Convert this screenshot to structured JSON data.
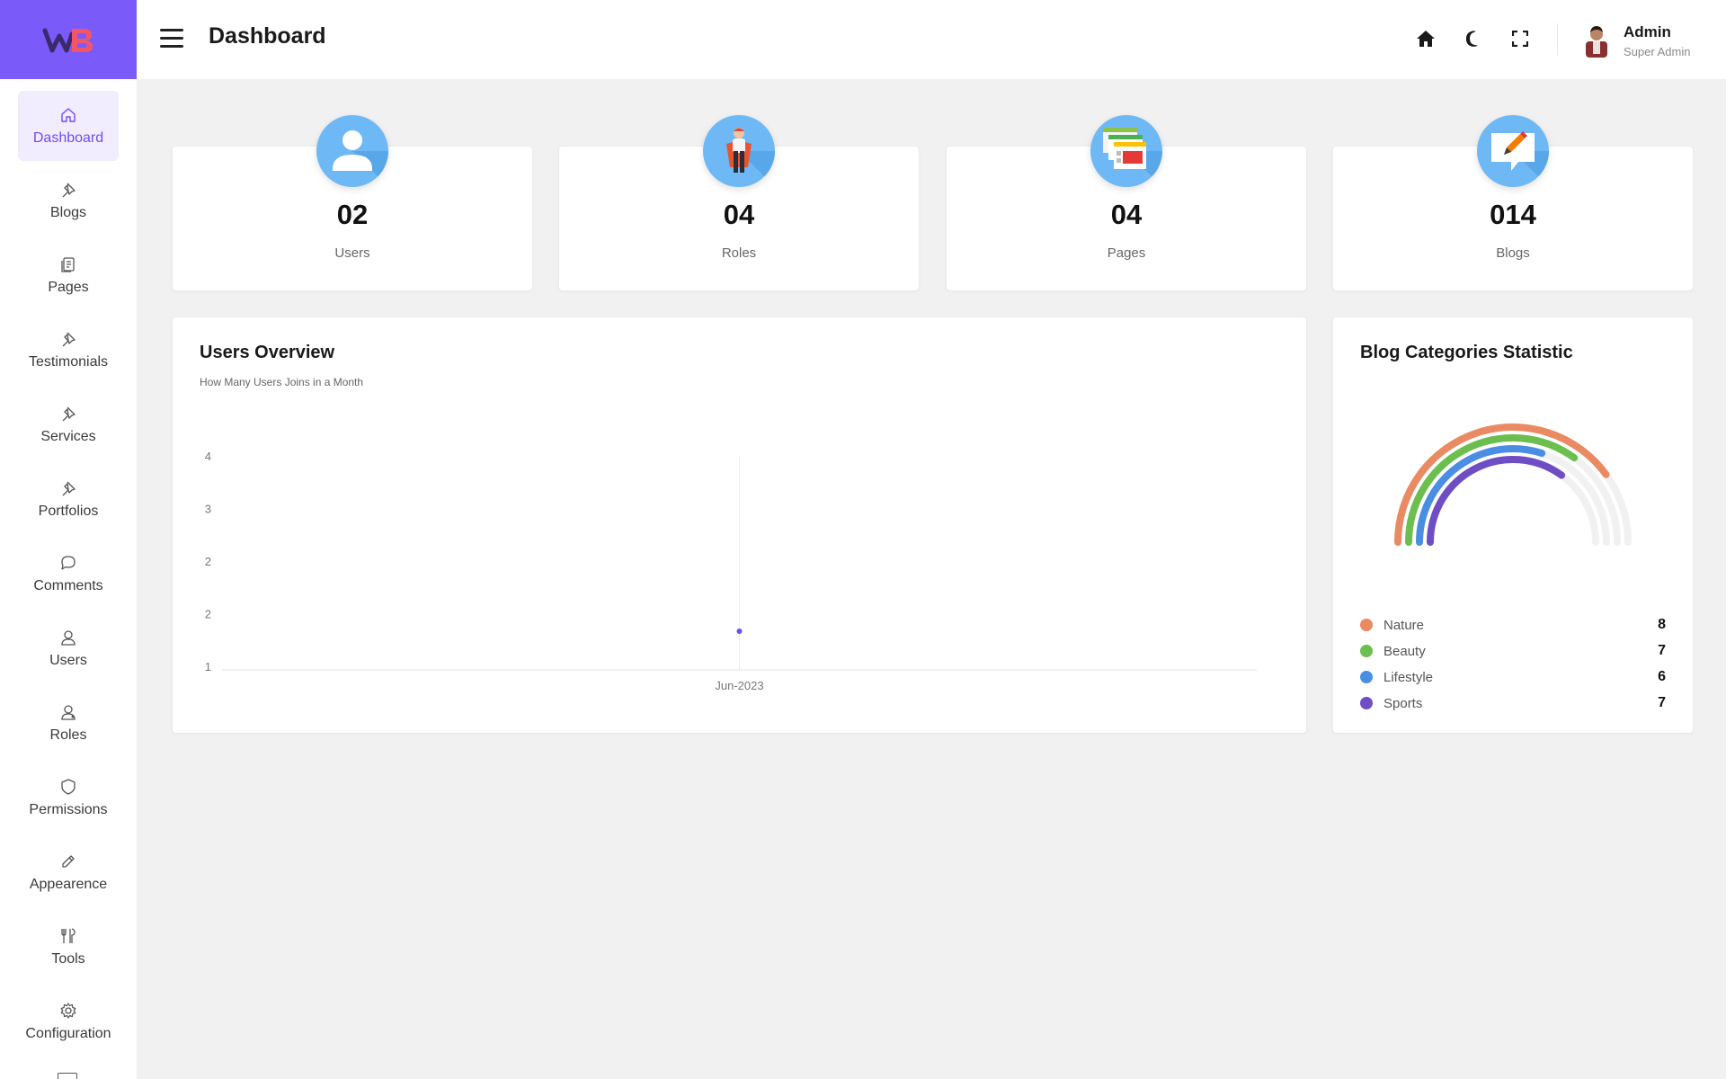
{
  "brand": {
    "accent": "#7a5af8"
  },
  "header": {
    "title": "Dashboard"
  },
  "user": {
    "name": "Admin",
    "role": "Super Admin"
  },
  "sidebar": {
    "items": [
      {
        "label": "Dashboard",
        "icon": "home-icon"
      },
      {
        "label": "Blogs",
        "icon": "pin-icon"
      },
      {
        "label": "Pages",
        "icon": "pages-icon"
      },
      {
        "label": "Testimonials",
        "icon": "pin-icon"
      },
      {
        "label": "Services",
        "icon": "pin-icon"
      },
      {
        "label": "Portfolios",
        "icon": "pin-icon"
      },
      {
        "label": "Comments",
        "icon": "comment-icon"
      },
      {
        "label": "Users",
        "icon": "user-icon"
      },
      {
        "label": "Roles",
        "icon": "roles-icon"
      },
      {
        "label": "Permissions",
        "icon": "shield-icon"
      },
      {
        "label": "Appearence",
        "icon": "pencil-icon"
      },
      {
        "label": "Tools",
        "icon": "tools-icon"
      },
      {
        "label": "Configuration",
        "icon": "gear-icon"
      }
    ]
  },
  "stats": [
    {
      "value": "02",
      "label": "Users"
    },
    {
      "value": "04",
      "label": "Roles"
    },
    {
      "value": "04",
      "label": "Pages"
    },
    {
      "value": "014",
      "label": "Blogs"
    }
  ],
  "users_overview": {
    "title": "Users Overview",
    "subtitle": "How Many Users Joins in a Month"
  },
  "blog_categories": {
    "title": "Blog Categories Statistic"
  },
  "chart_data": [
    {
      "type": "line",
      "x": [
        "Jun-2023"
      ],
      "series": [
        {
          "values": [
            1.5
          ]
        }
      ],
      "y_tick_labels": [
        "4",
        "3",
        "2",
        "2",
        "1"
      ],
      "xlabel": "",
      "ylabel": "",
      "ylim": [
        1,
        4
      ],
      "grid": false,
      "color": "#6f4ef2"
    },
    {
      "type": "pie",
      "style": "radial-bar",
      "categories": [
        "Nature",
        "Beauty",
        "Lifestyle",
        "Sports"
      ],
      "values": [
        8,
        7,
        6,
        7
      ],
      "colors": [
        "#ea8a63",
        "#6cbf4e",
        "#4a8ee4",
        "#6f4ec4"
      ],
      "legend": "bottom"
    }
  ]
}
